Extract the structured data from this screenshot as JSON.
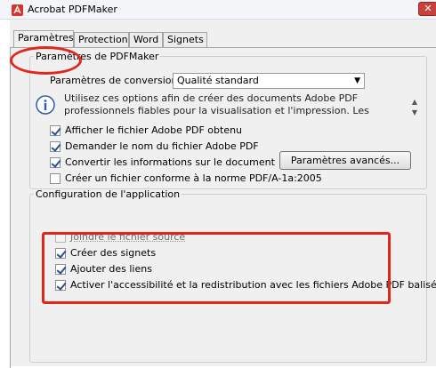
{
  "window": {
    "title": "Acrobat PDFMaker",
    "close_glyph": "✕"
  },
  "tabs": [
    {
      "label": "Paramètres",
      "active": true
    },
    {
      "label": "Protection",
      "active": false
    },
    {
      "label": "Word",
      "active": false
    },
    {
      "label": "Signets",
      "active": false
    }
  ],
  "pdfmaker_group": {
    "legend": "Paramètres de PDFMaker",
    "conversion_label": "Paramètres de conversion :",
    "conversion_value": "Qualité standard",
    "description": "Utilisez ces options afin de créer des documents Adobe PDF professionnels fiables pour la visualisation et l'impression. Les documents PDF créés peuvent être",
    "options": [
      {
        "label": "Afficher le fichier Adobe PDF obtenu",
        "checked": true
      },
      {
        "label": "Demander le nom du fichier Adobe PDF",
        "checked": true
      },
      {
        "label": "Convertir les informations sur le document",
        "checked": true
      },
      {
        "label": "Créer un fichier conforme à la norme PDF/A-1a:2005",
        "checked": false
      }
    ],
    "advanced_button": "Paramètres avancés..."
  },
  "app_group": {
    "legend": "Configuration de l'application",
    "options": [
      {
        "label": "Joindre le fichier source",
        "checked": false,
        "disabled": true
      },
      {
        "label": "Créer des signets",
        "checked": true
      },
      {
        "label": "Ajouter des liens",
        "checked": true
      },
      {
        "label": "Activer l'accessibilité et la redistribution avec les fichiers Adobe PDF balisés",
        "checked": true
      }
    ]
  },
  "annotations": {
    "highlight_color": "#e3261c"
  }
}
